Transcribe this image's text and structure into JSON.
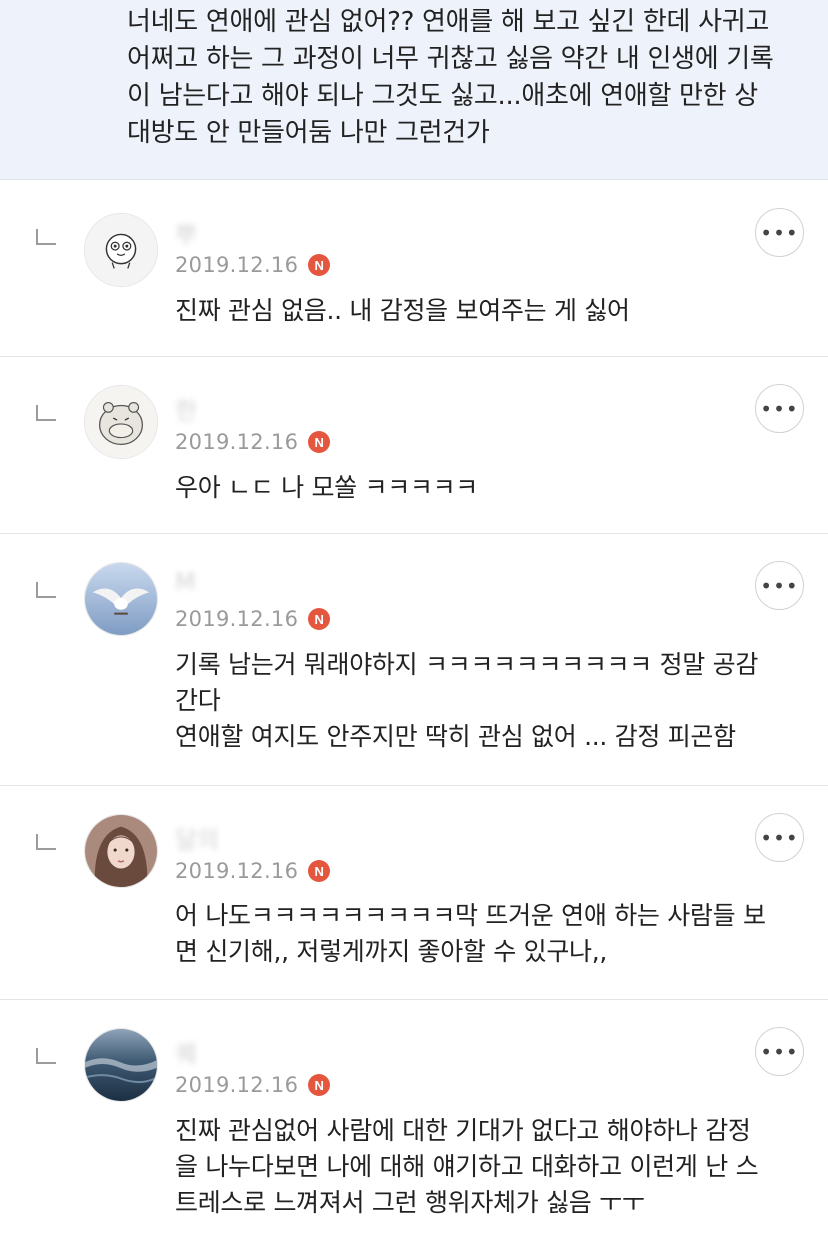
{
  "post": {
    "text": "너네도 연애에 관심 없어?? 연애를 해 보고 싶긴 한데 사귀고\n어쩌고 하는 그 과정이 너무 귀찮고 싫음 약간 내 인생에 기록\n이 남는다고 해야 되나 그것도 싫고...애초에 연애할 만한 상\n대방도 안 만들어둠 나만 그런건가"
  },
  "comments": [
    {
      "nickname": "뿌",
      "date": "2019.12.16",
      "badge": "N",
      "more_label": "•••",
      "text": "진짜 관심 없음.. 내 감정을 보여주는 게 싫어",
      "avatar_icon": "cartoon-character-avatar"
    },
    {
      "nickname": "한",
      "date": "2019.12.16",
      "badge": "N",
      "more_label": "•••",
      "text": "우아 ㄴㄷ 나 모쏠 ㅋㅋㅋㅋㅋ",
      "avatar_icon": "hippo-character-avatar"
    },
    {
      "nickname": "M",
      "date": "2019.12.16",
      "badge": "N",
      "more_label": "•••",
      "text": "기록 남는거 뭐래야하지 ㅋㅋㅋㅋㅋㅋㅋㅋㅋㅋ 정말 공감\n간다\n연애할 여지도 안주지만 딱히 관심 없어 ... 감정 피곤함",
      "avatar_icon": "bird-photo-avatar"
    },
    {
      "nickname": "달의",
      "date": "2019.12.16",
      "badge": "N",
      "more_label": "•••",
      "text": "어 나도ㅋㅋㅋㅋㅋㅋㅋㅋㅋ막 뜨거운 연애 하는 사람들 보\n면 신기해,, 저렇게까지 좋아할 수 있구나,,",
      "avatar_icon": "person-photo-avatar"
    },
    {
      "nickname": "퀘",
      "date": "2019.12.16",
      "badge": "N",
      "more_label": "•••",
      "text": "진짜 관심없어 사람에 대한 기대가 없다고 해야하나 감정\n을 나누다보면 나에 대해 얘기하고 대화하고 이런게 난 스\n트레스로 느껴져서 그런 행위자체가 싫음 ㅜㅜ",
      "avatar_icon": "sea-wave-photo-avatar"
    }
  ]
}
